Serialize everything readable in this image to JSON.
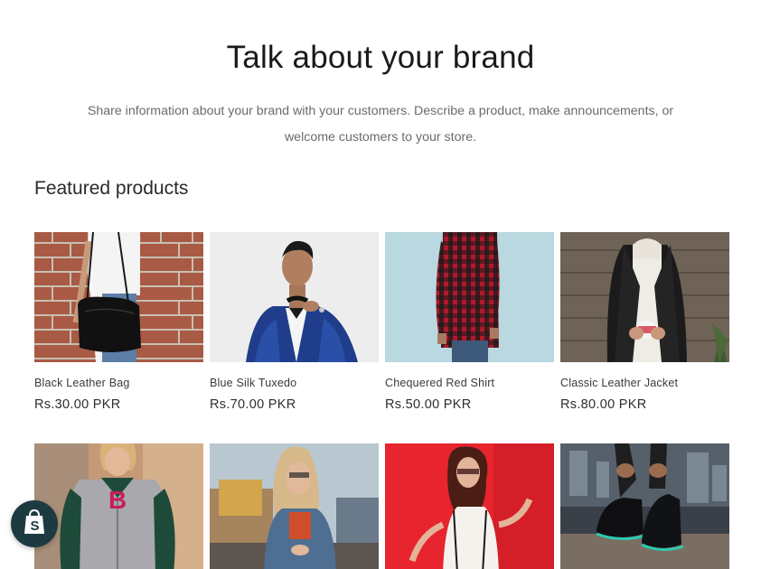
{
  "brand": {
    "title": "Talk about your brand",
    "text": "Share information about your brand with your customers. Describe a product, make announcements, or welcome customers to your store."
  },
  "featured": {
    "heading": "Featured products",
    "products": [
      {
        "title": "Black Leather Bag",
        "price": "Rs.30.00 PKR"
      },
      {
        "title": "Blue Silk Tuxedo",
        "price": "Rs.70.00 PKR"
      },
      {
        "title": "Chequered Red Shirt",
        "price": "Rs.50.00 PKR"
      },
      {
        "title": "Classic Leather Jacket",
        "price": "Rs.80.00 PKR"
      },
      {
        "title": "",
        "price": ""
      },
      {
        "title": "",
        "price": ""
      },
      {
        "title": "",
        "price": ""
      },
      {
        "title": "",
        "price": ""
      }
    ]
  },
  "shopify_badge": {
    "icon": "shopify-bag-icon",
    "color": "#1d3a40"
  }
}
